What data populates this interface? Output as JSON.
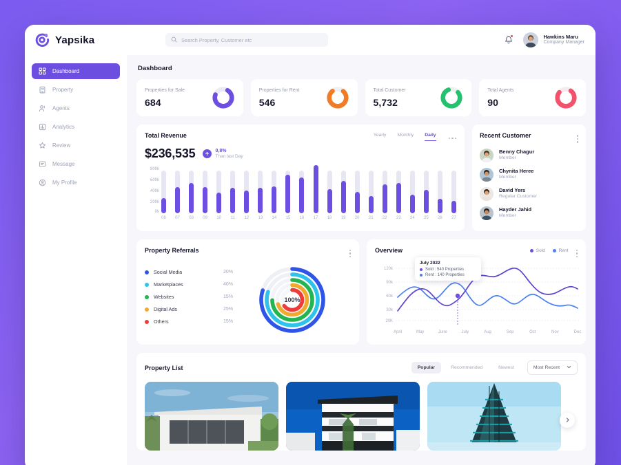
{
  "brand": {
    "name": "Yapsika",
    "logo_icon": "yapsika-logo-icon",
    "accent": "#6c4ee0"
  },
  "search": {
    "placeholder": "Search Property, Customer etc",
    "value": "",
    "icon": "search-icon"
  },
  "header": {
    "notification_icon": "bell-icon",
    "user": {
      "name": "Hawkins Maru",
      "role": "Company Manager"
    }
  },
  "sidebar": {
    "items": [
      {
        "label": "Dashboard",
        "icon": "grid-icon",
        "active": true
      },
      {
        "label": "Property",
        "icon": "building-icon",
        "active": false
      },
      {
        "label": "Agents",
        "icon": "users-icon",
        "active": false
      },
      {
        "label": "Analytics",
        "icon": "bar-chart-icon",
        "active": false
      },
      {
        "label": "Review",
        "icon": "star-icon",
        "active": false
      },
      {
        "label": "Message",
        "icon": "message-icon",
        "active": false
      },
      {
        "label": "My Profile",
        "icon": "user-circle-icon",
        "active": false
      }
    ]
  },
  "page": {
    "title": "Dashboard"
  },
  "stats": [
    {
      "label": "Properties for Sale",
      "value": "684",
      "color": "#6c4ee0",
      "percent": 72
    },
    {
      "label": "Properties for Rent",
      "value": "546",
      "color": "#f07c28",
      "percent": 78
    },
    {
      "label": "Total Customer",
      "value": "5,732",
      "color": "#25c16f",
      "percent": 80
    },
    {
      "label": "Total Agents",
      "value": "90",
      "color": "#f2526b",
      "percent": 76
    }
  ],
  "revenue": {
    "title": "Total Revenue",
    "amount": "$236,535",
    "delta_percent": "0,8%",
    "delta_sub": "Than last Day",
    "delta_icon": "arrow-up-icon",
    "tabs": [
      {
        "label": "Yearly",
        "active": false
      },
      {
        "label": "Monthly",
        "active": false
      },
      {
        "label": "Daily",
        "active": true
      }
    ],
    "menu_icon": "more-horizontal-icon"
  },
  "chart_data": [
    {
      "type": "bar",
      "title": "Total Revenue",
      "xlabel": "",
      "ylabel": "",
      "ylim": [
        0,
        800000
      ],
      "grid": false,
      "ytick_labels": [
        "0k",
        "200k",
        "400k",
        "600k",
        "800k"
      ],
      "yticks": [
        0,
        200000,
        400000,
        600000,
        800000
      ],
      "track_max": 620000,
      "categories": [
        "06",
        "07",
        "08",
        "09",
        "10",
        "11",
        "12",
        "13",
        "14",
        "15",
        "16",
        "17",
        "18",
        "19",
        "20",
        "21",
        "22",
        "23",
        "24",
        "25",
        "26",
        "27"
      ],
      "values": [
        220000,
        380000,
        440000,
        380000,
        300000,
        370000,
        330000,
        370000,
        390000,
        560000,
        520000,
        700000,
        350000,
        470000,
        310000,
        250000,
        420000,
        440000,
        270000,
        340000,
        210000,
        180000
      ],
      "series_color": "#6c4ee0",
      "track_color": "#e6e7f2"
    },
    {
      "type": "line",
      "title": "Overview",
      "xlabel": "",
      "ylabel": "",
      "grid": true,
      "legend_position": "top-right",
      "ytick_labels": [
        "20K",
        "30k",
        "60k",
        "90k",
        "120k"
      ],
      "x": [
        "April",
        "May",
        "June",
        "July",
        "Aug",
        "Sep",
        "Oct",
        "Nov",
        "Dec"
      ],
      "series": [
        {
          "name": "Sold",
          "color": "#6c4ee0",
          "values": [
            25,
            58,
            40,
            62,
            95,
            100,
            115,
            60,
            72
          ]
        },
        {
          "name": "Rent",
          "color": "#4a7ff0",
          "values": [
            52,
            33,
            68,
            31,
            47,
            33,
            48,
            36,
            24
          ]
        }
      ],
      "tooltip": {
        "title": "July 2022",
        "rows": [
          {
            "label": "Sold : 540 Properties",
            "color": "#6c4ee0"
          },
          {
            "label": "Rent : 140 Properties",
            "color": "#4a7ff0"
          }
        ]
      }
    },
    {
      "type": "pie",
      "title": "Property Referrals",
      "center_label": "100%",
      "categories": [
        "Social Media",
        "Marketplaces",
        "Websites",
        "Digital Ads",
        "Others"
      ],
      "values": [
        20,
        40,
        15,
        25,
        15
      ],
      "colors": [
        "#2f55e8",
        "#2ec3ea",
        "#24b551",
        "#f0ab2e",
        "#ef3b3b"
      ]
    }
  ],
  "referrals": {
    "title": "Property Referrals",
    "menu_icon": "more-vertical-icon",
    "center_label": "100%",
    "rows": [
      {
        "name": "Social Media",
        "percent": "20%",
        "color": "#2f55e8"
      },
      {
        "name": "Marketplaces",
        "percent": "40%",
        "color": "#2ec3ea"
      },
      {
        "name": "Websites",
        "percent": "15%",
        "color": "#24b551"
      },
      {
        "name": "Digital Ads",
        "percent": "25%",
        "color": "#f0ab2e"
      },
      {
        "name": "Others",
        "percent": "15%",
        "color": "#ef3b3b"
      }
    ]
  },
  "recent_customer": {
    "title": "Recent Customer",
    "menu_icon": "more-vertical-icon",
    "customers": [
      {
        "name": "Benny Chagur",
        "role": "Member"
      },
      {
        "name": "Chynita Heree",
        "role": "Member"
      },
      {
        "name": "David Yers",
        "role": "Regular Customer"
      },
      {
        "name": "Hayder Jahid",
        "role": "Member"
      }
    ]
  },
  "overview": {
    "title": "Overview",
    "menu_icon": "more-vertical-icon",
    "legend": [
      {
        "label": "Sold",
        "color": "#6c4ee0"
      },
      {
        "label": "Rent",
        "color": "#4a7ff0"
      }
    ],
    "tooltip_title": "July 2022",
    "tooltip_sold": "Sold : 540 Properties",
    "tooltip_rent": "Rent : 140 Properties"
  },
  "property_list": {
    "title": "Property List",
    "chips": [
      {
        "label": "Popular",
        "active": true
      },
      {
        "label": "Recommended",
        "active": false
      },
      {
        "label": "Newest",
        "active": false
      }
    ],
    "sort": {
      "label": "Most Recent",
      "icon": "chevron-down-icon"
    },
    "next_icon": "chevron-right-icon",
    "cards": [
      {
        "name": "villa-exterior-photo"
      },
      {
        "name": "modern-house-photo"
      },
      {
        "name": "glass-tower-photo"
      }
    ]
  }
}
